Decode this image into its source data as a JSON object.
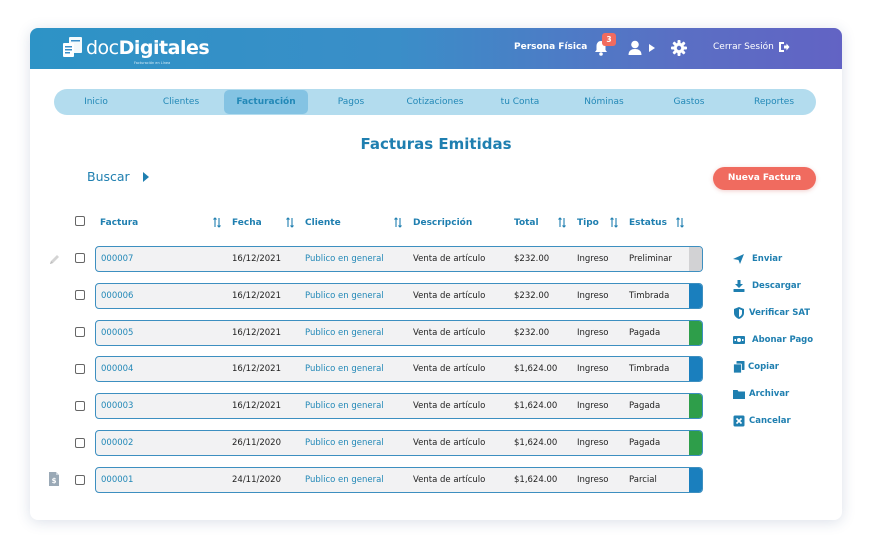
{
  "app": {
    "logo_light": "doc",
    "logo_bold": "Digitales",
    "logo_tagline": "Facturación en Línea"
  },
  "header": {
    "persona": "Persona Física",
    "notifications_count": "3",
    "logout_label": "Cerrar Sesión"
  },
  "nav": {
    "items": [
      "Inicio",
      "Clientes",
      "Facturación",
      "Pagos",
      "Cotizaciones",
      "tu Conta",
      "Nóminas",
      "Gastos",
      "Reportes"
    ],
    "active": "Facturación"
  },
  "page_title": "Facturas Emitidas",
  "search": {
    "label": "Buscar"
  },
  "new_invoice_button": "Nueva Factura",
  "table": {
    "headers": {
      "factura": "Factura",
      "fecha": "Fecha",
      "cliente": "Cliente",
      "descripcion": "Descripción",
      "total": "Total",
      "tipo": "Tipo",
      "estatus": "Estatus"
    },
    "rows": [
      {
        "factura": "000007",
        "fecha": "16/12/2021",
        "cliente": "Publico en general",
        "descripcion": "Venta de artículo",
        "total": "$232.00",
        "tipo": "Ingreso",
        "estatus": "Preliminar",
        "status_color": "#d2d2d4"
      },
      {
        "factura": "000006",
        "fecha": "16/12/2021",
        "cliente": "Publico en general",
        "descripcion": "Venta de artículo",
        "total": "$232.00",
        "tipo": "Ingreso",
        "estatus": "Timbrada",
        "status_color": "#1a7fbe"
      },
      {
        "factura": "000005",
        "fecha": "16/12/2021",
        "cliente": "Publico en general",
        "descripcion": "Venta de artículo",
        "total": "$232.00",
        "tipo": "Ingreso",
        "estatus": "Pagada",
        "status_color": "#2e9e4a"
      },
      {
        "factura": "000004",
        "fecha": "16/12/2021",
        "cliente": "Publico en general",
        "descripcion": "Venta de artículo",
        "total": "$1,624.00",
        "tipo": "Ingreso",
        "estatus": "Timbrada",
        "status_color": "#1a7fbe"
      },
      {
        "factura": "000003",
        "fecha": "16/12/2021",
        "cliente": "Publico en general",
        "descripcion": "Venta de artículo",
        "total": "$1,624.00",
        "tipo": "Ingreso",
        "estatus": "Pagada",
        "status_color": "#2e9e4a"
      },
      {
        "factura": "000002",
        "fecha": "26/11/2020",
        "cliente": "Publico en general",
        "descripcion": "Venta de artículo",
        "total": "$1,624.00",
        "tipo": "Ingreso",
        "estatus": "Pagada",
        "status_color": "#2e9e4a"
      },
      {
        "factura": "000001",
        "fecha": "24/11/2020",
        "cliente": "Publico en general",
        "descripcion": "Venta de artículo",
        "total": "$1,624.00",
        "tipo": "Ingreso",
        "estatus": "Parcial",
        "status_color": "#1a7fbe"
      }
    ]
  },
  "actions": [
    {
      "label": "Enviar",
      "icon": "send-icon"
    },
    {
      "label": "Descargar",
      "icon": "download-icon"
    },
    {
      "label": "Verificar SAT",
      "icon": "shield-icon"
    },
    {
      "label": "Abonar Pago",
      "icon": "money-icon"
    },
    {
      "label": "Copiar",
      "icon": "copy-icon"
    },
    {
      "label": "Archivar",
      "icon": "folder-icon"
    },
    {
      "label": "Cancelar",
      "icon": "cancel-icon"
    }
  ],
  "colors": {
    "brand_blue": "#1f7fb0",
    "accent_coral": "#f06b5f",
    "status_gray": "#d2d2d4",
    "status_blue": "#1a7fbe",
    "status_green": "#2e9e4a"
  }
}
